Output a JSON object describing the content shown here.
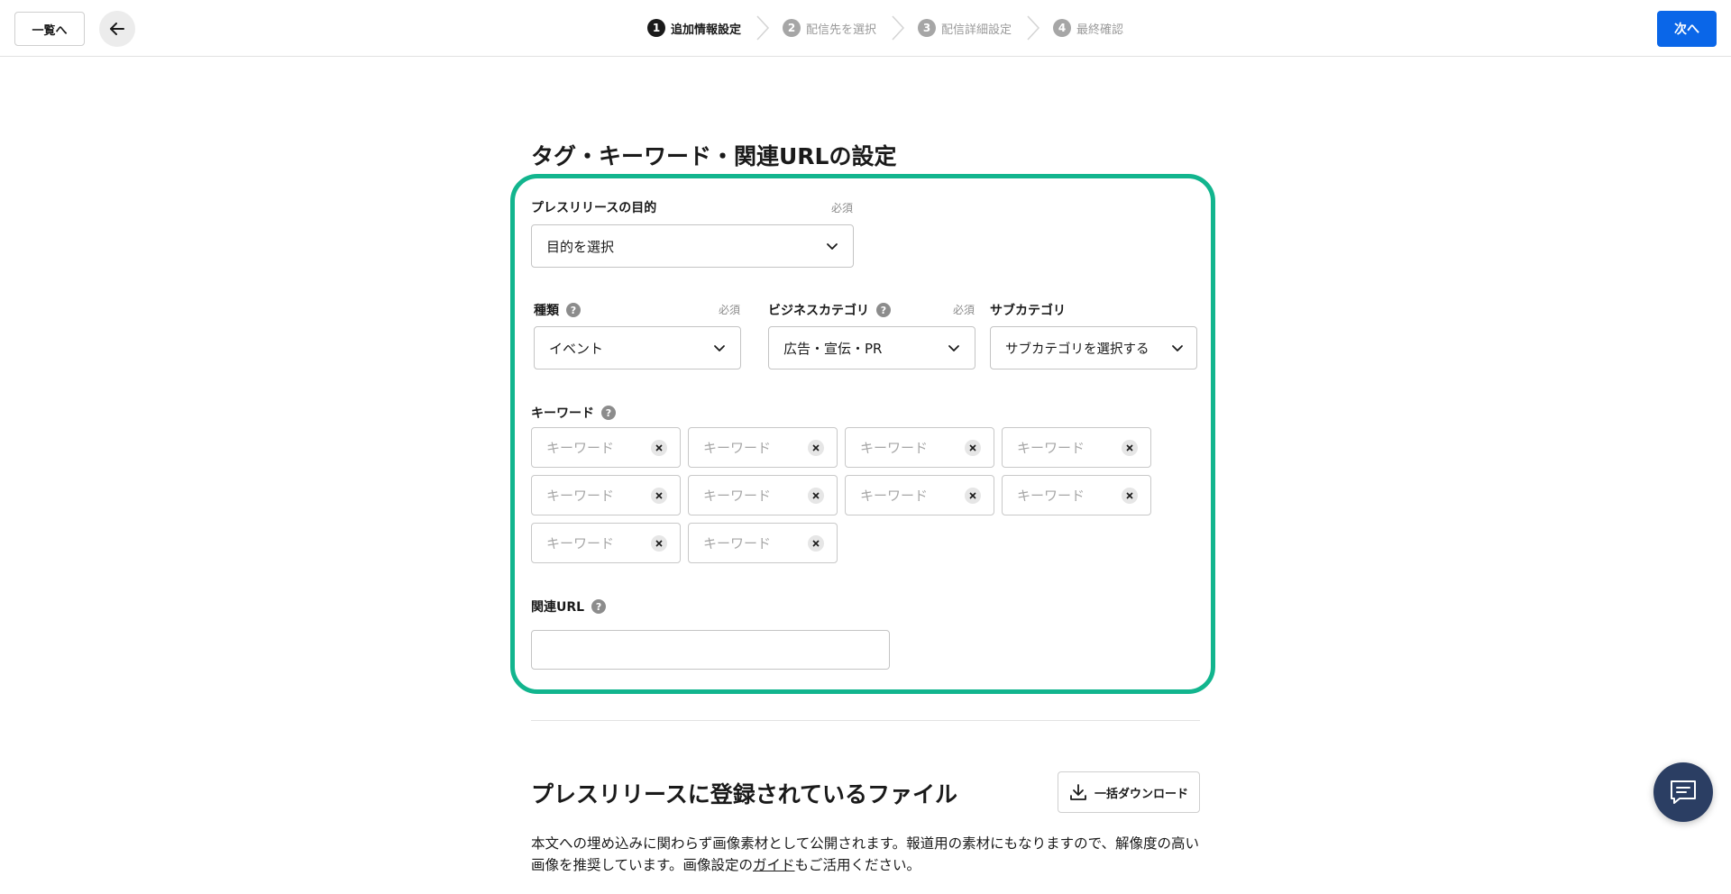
{
  "header": {
    "list_label": "一覧へ",
    "next_label": "次へ",
    "steps": [
      {
        "num": "1",
        "label": "追加情報設定"
      },
      {
        "num": "2",
        "label": "配信先を選択"
      },
      {
        "num": "3",
        "label": "配信詳細設定"
      },
      {
        "num": "4",
        "label": "最終確認"
      }
    ]
  },
  "section": {
    "title": "タグ・キーワード・関連URLの設定",
    "purpose": {
      "label": "プレスリリースの目的",
      "required": "必須",
      "value": "目的を選択"
    },
    "type": {
      "label": "種類",
      "required": "必須",
      "value": "イベント"
    },
    "business_category": {
      "label": "ビジネスカテゴリ",
      "required": "必須",
      "value": "広告・宣伝・PR"
    },
    "sub_category": {
      "label": "サブカテゴリ",
      "value": "サブカテゴリを選択する"
    },
    "keywords": {
      "label": "キーワード",
      "placeholder": "キーワード",
      "count": 10
    },
    "related_url": {
      "label": "関連URL",
      "value": ""
    }
  },
  "files": {
    "title": "プレスリリースに登録されているファイル",
    "download_label": "一括ダウンロード",
    "desc_before": "本文への埋め込みに関わらず画像素材として公開されます。報道用の素材にもなりますので、解像度の高い画像を推奨しています。画像設定の",
    "desc_link": "ガイド",
    "desc_after": "もご活用ください。"
  },
  "icons": {
    "back": "arrow-left-icon",
    "chevron": "chevron-down-icon",
    "help": "question-icon",
    "clear": "close-icon",
    "download": "download-icon",
    "chat": "chat-icon"
  },
  "colors": {
    "accent": "#0a66e8",
    "highlight": "#12b58e",
    "chat": "#2b3e63"
  }
}
